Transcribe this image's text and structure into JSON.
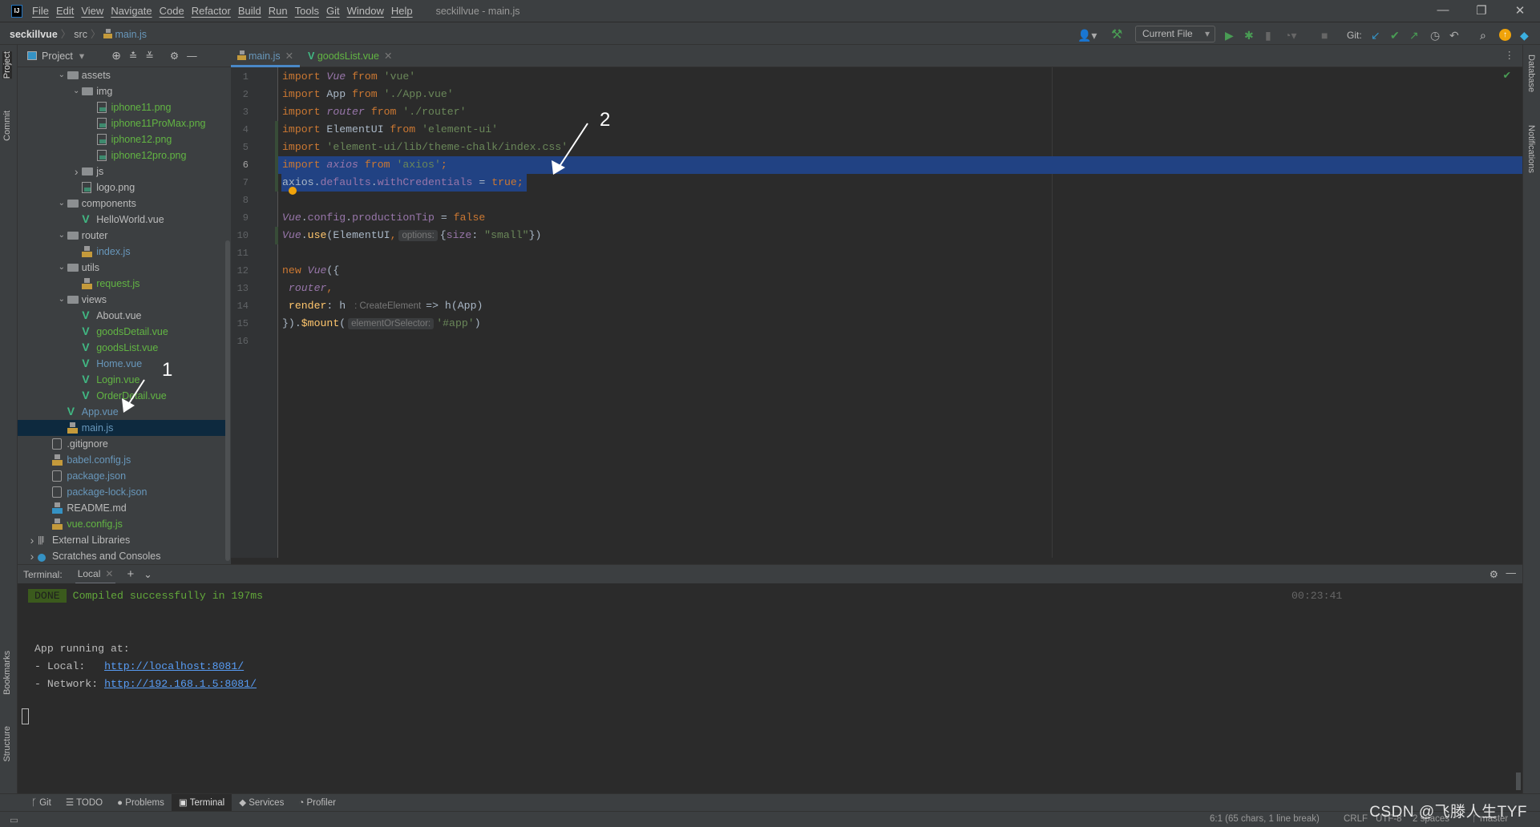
{
  "titlebar": {
    "menu": [
      "File",
      "Edit",
      "View",
      "Navigate",
      "Code",
      "Refactor",
      "Build",
      "Run",
      "Tools",
      "Git",
      "Window",
      "Help"
    ],
    "title": "seckillvue - main.js"
  },
  "navbar": {
    "project": "seckillvue",
    "folder": "src",
    "file": "main.js",
    "run_config": "Current File",
    "git_label": "Git:"
  },
  "left_stripe": {
    "project": "Project",
    "commit": "Commit",
    "bookmarks": "Bookmarks",
    "structure": "Structure"
  },
  "right_stripe": {
    "database": "Database",
    "notifications": "Notifications"
  },
  "project_panel": {
    "title": "Project",
    "tree": [
      {
        "name": "assets",
        "level": 2,
        "type": "folder",
        "open": true,
        "color": "white"
      },
      {
        "name": "img",
        "level": 3,
        "type": "folder",
        "open": true,
        "color": "white"
      },
      {
        "name": "iphone11.png",
        "level": 4,
        "type": "img",
        "color": "green"
      },
      {
        "name": "iphone11ProMax.png",
        "level": 4,
        "type": "img",
        "color": "green"
      },
      {
        "name": "iphone12.png",
        "level": 4,
        "type": "img",
        "color": "green"
      },
      {
        "name": "iphone12pro.png",
        "level": 4,
        "type": "img",
        "color": "green"
      },
      {
        "name": "js",
        "level": 3,
        "type": "folder",
        "open": false,
        "color": "white"
      },
      {
        "name": "logo.png",
        "level": 3,
        "type": "img",
        "color": "white"
      },
      {
        "name": "components",
        "level": 2,
        "type": "folder",
        "open": true,
        "color": "white"
      },
      {
        "name": "HelloWorld.vue",
        "level": 3,
        "type": "vue",
        "color": "white"
      },
      {
        "name": "router",
        "level": 2,
        "type": "folder",
        "open": true,
        "color": "white"
      },
      {
        "name": "index.js",
        "level": 3,
        "type": "js",
        "color": "blue"
      },
      {
        "name": "utils",
        "level": 2,
        "type": "folder",
        "open": true,
        "color": "white"
      },
      {
        "name": "request.js",
        "level": 3,
        "type": "js",
        "color": "green"
      },
      {
        "name": "views",
        "level": 2,
        "type": "folder",
        "open": true,
        "color": "white"
      },
      {
        "name": "About.vue",
        "level": 3,
        "type": "vue",
        "color": "white"
      },
      {
        "name": "goodsDetail.vue",
        "level": 3,
        "type": "vue",
        "color": "green"
      },
      {
        "name": "goodsList.vue",
        "level": 3,
        "type": "vue",
        "color": "green"
      },
      {
        "name": "Home.vue",
        "level": 3,
        "type": "vue",
        "color": "blue"
      },
      {
        "name": "Login.vue",
        "level": 3,
        "type": "vue",
        "color": "green"
      },
      {
        "name": "OrderDetail.vue",
        "level": 3,
        "type": "vue",
        "color": "green"
      },
      {
        "name": "App.vue",
        "level": 2,
        "type": "vue",
        "color": "blue"
      },
      {
        "name": "main.js",
        "level": 2,
        "type": "js",
        "color": "blue",
        "selected": true
      },
      {
        "name": ".gitignore",
        "level": 1,
        "type": "cfg",
        "color": "white"
      },
      {
        "name": "babel.config.js",
        "level": 1,
        "type": "js",
        "color": "blue"
      },
      {
        "name": "package.json",
        "level": 1,
        "type": "cfg",
        "color": "blue"
      },
      {
        "name": "package-lock.json",
        "level": 1,
        "type": "cfg",
        "color": "blue"
      },
      {
        "name": "README.md",
        "level": 1,
        "type": "md",
        "color": "white"
      },
      {
        "name": "vue.config.js",
        "level": 1,
        "type": "js",
        "color": "green"
      },
      {
        "name": "External Libraries",
        "level": 0,
        "type": "lib",
        "open": false,
        "color": "white"
      },
      {
        "name": "Scratches and Consoles",
        "level": 0,
        "type": "scratch",
        "open": false,
        "color": "white"
      }
    ]
  },
  "tabs": [
    {
      "label": "main.js",
      "icon": "js",
      "active": true,
      "color": "#6897bb"
    },
    {
      "label": "goodsList.vue",
      "icon": "vue",
      "active": false,
      "color": "#62b543"
    }
  ],
  "editor": {
    "current_line": 6,
    "lines": [
      [
        [
          "k",
          "import"
        ],
        [
          "",
          " "
        ],
        [
          "i",
          "Vue"
        ],
        [
          "",
          " "
        ],
        [
          "k",
          "from"
        ],
        [
          "",
          " "
        ],
        [
          "s",
          "'vue'"
        ]
      ],
      [
        [
          "k",
          "import"
        ],
        [
          "",
          " App "
        ],
        [
          "k",
          "from"
        ],
        [
          "",
          " "
        ],
        [
          "s",
          "'./App.vue'"
        ]
      ],
      [
        [
          "k",
          "import"
        ],
        [
          "",
          " "
        ],
        [
          "i",
          "router"
        ],
        [
          "",
          " "
        ],
        [
          "k",
          "from"
        ],
        [
          "",
          " "
        ],
        [
          "s",
          "'./router'"
        ]
      ],
      [
        [
          "k",
          "import"
        ],
        [
          "",
          " ElementUI "
        ],
        [
          "k",
          "from"
        ],
        [
          "",
          " "
        ],
        [
          "s",
          "'element-ui'"
        ]
      ],
      [
        [
          "k",
          "import"
        ],
        [
          "",
          " "
        ],
        [
          "s",
          "'element-ui/lib/theme-chalk/index.css'"
        ]
      ],
      [
        [
          "k",
          "import"
        ],
        [
          "",
          " "
        ],
        [
          "i",
          "axios"
        ],
        [
          "",
          " "
        ],
        [
          "k",
          "from"
        ],
        [
          "",
          " "
        ],
        [
          "s",
          "'axios'"
        ],
        [
          "k",
          ";"
        ]
      ],
      [
        [
          "",
          "axios."
        ],
        [
          "p",
          "defaults"
        ],
        [
          "",
          "."
        ],
        [
          "p",
          "withCredentials"
        ],
        [
          "",
          " = "
        ],
        [
          "k",
          "true"
        ],
        [
          "k",
          ";"
        ]
      ],
      [],
      [
        [
          "i",
          "Vue"
        ],
        [
          "",
          "."
        ],
        [
          "p",
          "config"
        ],
        [
          "",
          "."
        ],
        [
          "p",
          "productionTip"
        ],
        [
          "",
          " = "
        ],
        [
          "k",
          "false"
        ]
      ],
      [
        [
          "i",
          "Vue"
        ],
        [
          "",
          "."
        ],
        [
          "f",
          "use"
        ],
        [
          "",
          "(ElementUI"
        ],
        [
          "k",
          ","
        ],
        [
          "h",
          "options:"
        ],
        [
          "",
          "{"
        ],
        [
          "p",
          "size"
        ],
        [
          "",
          ": "
        ],
        [
          "s",
          "\"small\""
        ],
        [
          "",
          "})"
        ]
      ],
      [],
      [
        [
          "k",
          "new"
        ],
        [
          "",
          " "
        ],
        [
          "i",
          "Vue"
        ],
        [
          "",
          "({"
        ]
      ],
      [
        [
          "",
          " "
        ],
        [
          "i",
          "router"
        ],
        [
          "k",
          ","
        ]
      ],
      [
        [
          "",
          " "
        ],
        [
          "f",
          "render"
        ],
        [
          "",
          ": h "
        ],
        [
          "hn",
          ": CreateElement"
        ],
        [
          "",
          "=> h(App)"
        ]
      ],
      [
        [
          "",
          "})."
        ],
        [
          "f",
          "$mount"
        ],
        [
          "",
          "("
        ],
        [
          "h",
          "elementOrSelector:"
        ],
        [
          "s",
          "'#app'"
        ],
        [
          "",
          ")"
        ]
      ],
      []
    ],
    "changed_lines": [
      4,
      5,
      6,
      7,
      10
    ]
  },
  "annotations": {
    "arrow1": "1",
    "arrow2": "2"
  },
  "terminal": {
    "label": "Terminal:",
    "tab": "Local",
    "done_badge": "DONE",
    "compiled": "Compiled successfully in 197ms",
    "timestamp": "00:23:41",
    "running": "App running at:",
    "local_label": "- Local:   ",
    "local_url": "http://localhost:8081/",
    "network_label": "- Network: ",
    "network_url": "http://192.168.1.5:8081/"
  },
  "bottom_tools": [
    {
      "label": "Git",
      "icon": "git-branch"
    },
    {
      "label": "TODO",
      "icon": "list"
    },
    {
      "label": "Problems",
      "icon": "warning"
    },
    {
      "label": "Terminal",
      "icon": "terminal",
      "active": true
    },
    {
      "label": "Services",
      "icon": "services"
    },
    {
      "label": "Profiler",
      "icon": "profiler"
    }
  ],
  "status": {
    "position": "6:1 (65 chars, 1 line break)",
    "line_sep": "CRLF",
    "encoding": "UTF-8",
    "indent": "2 spaces",
    "branch": "master"
  },
  "watermark": "CSDN @飞滕人生TYF"
}
